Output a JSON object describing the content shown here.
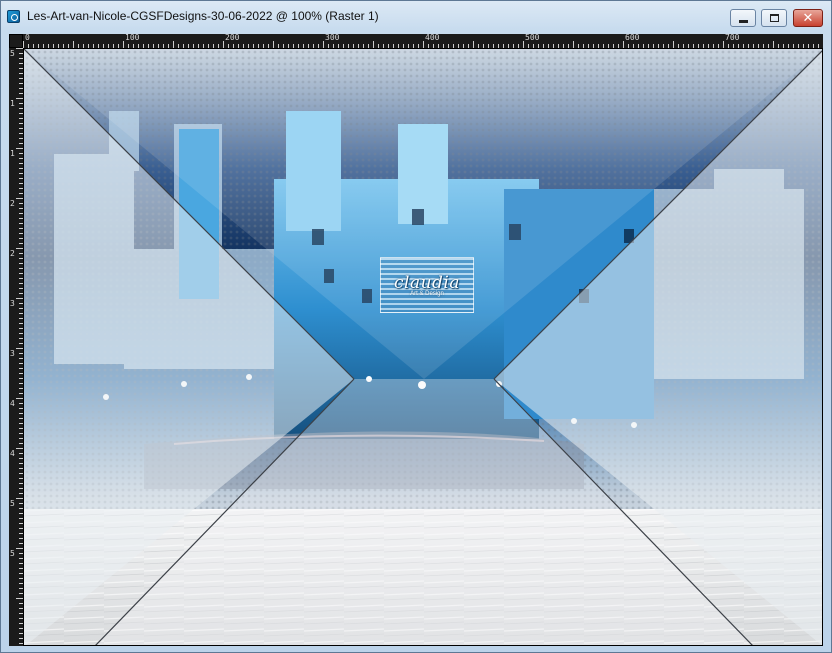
{
  "window": {
    "title": "Les-Art-van-Nicole-CGSFDesigns-30-06-2022 @ 100% (Raster 1)",
    "controls": {
      "minimize_icon": "minimize-icon",
      "maximize_icon": "maximize-icon",
      "close_icon": "close-icon"
    }
  },
  "ruler": {
    "horizontal_labels": [
      "0",
      "100",
      "200",
      "300",
      "400",
      "500",
      "600",
      "700"
    ],
    "vertical_labels": [
      "5",
      "1",
      "1",
      "2",
      "2",
      "3",
      "3",
      "4",
      "4",
      "5",
      "5"
    ]
  },
  "canvas": {
    "description_icon": "image-canvas",
    "watermark": {
      "text": "claudia",
      "subtext": "Art & Design"
    }
  },
  "colors": {
    "titlebar": "#c7dbee",
    "ruler_bg": "#1b1b1b",
    "castle_blue": "#2f8fd0",
    "sky_dark": "#0d2f5e",
    "close_red": "#c8412f"
  }
}
